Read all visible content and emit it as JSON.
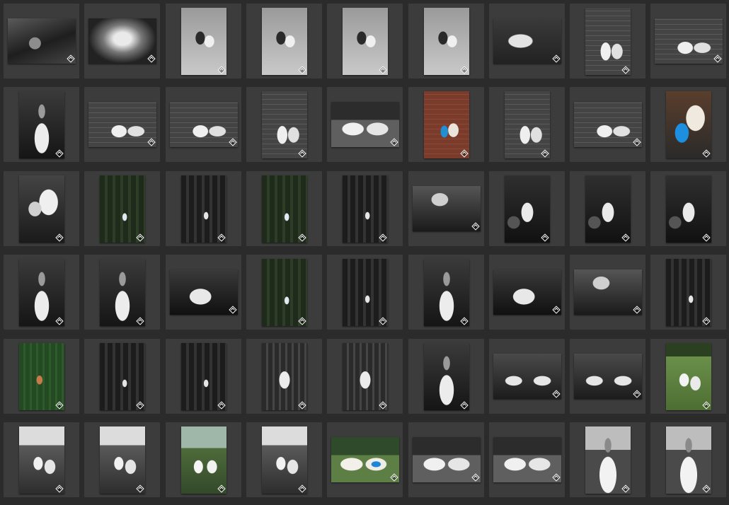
{
  "grid": {
    "columns": 9,
    "rows": [
      [
        "bw-grass",
        "bw-sheet",
        "bw-pair",
        "bw-pair",
        "bw-pair",
        "bw-pair",
        "bw-box",
        "bw-brick2",
        "bw-brick2"
      ],
      [
        "bw-girl",
        "bw-brick2",
        "bw-brick2",
        "bw-brick2",
        "bw-pair2",
        "col-brick",
        "bw-brick2",
        "bw-brick2",
        "col-cast"
      ],
      [
        "bw-cast",
        "col-forest",
        "bw-forest",
        "col-forest",
        "bw-forest",
        "bw-fern",
        "bw-rocks",
        "bw-rocks",
        "bw-rocks"
      ],
      [
        "bw-girl",
        "bw-girl",
        "bw-wide",
        "col-forest",
        "bw-forest",
        "bw-girl",
        "bw-wide",
        "bw-fern",
        "bw-forest"
      ],
      [
        "col-fernsit",
        "bw-forest",
        "bw-forest",
        "bw-ferngrp",
        "bw-ferngrp",
        "bw-girl",
        "bw-arms",
        "bw-arms",
        "col-field"
      ],
      [
        "bw-field",
        "bw-field",
        "col-sky",
        "bw-field",
        "col-pair",
        "bw-pair2",
        "bw-pair2",
        "bw-portrait",
        "bw-portrait"
      ]
    ],
    "orientation": [
      [
        "landscape",
        "landscape",
        "portrait",
        "portrait",
        "portrait",
        "portrait",
        "landscape",
        "portrait",
        "landscape"
      ],
      [
        "portrait",
        "landscape",
        "landscape",
        "portrait",
        "landscape",
        "portrait",
        "portrait",
        "landscape",
        "portrait"
      ],
      [
        "portrait",
        "portrait",
        "portrait",
        "portrait",
        "portrait",
        "landscape",
        "portrait",
        "portrait",
        "portrait"
      ],
      [
        "portrait",
        "portrait",
        "landscape",
        "portrait",
        "portrait",
        "portrait",
        "landscape",
        "landscape",
        "portrait"
      ],
      [
        "portrait",
        "portrait",
        "portrait",
        "portrait",
        "portrait",
        "portrait",
        "landscape",
        "landscape",
        "portrait"
      ],
      [
        "portrait",
        "portrait",
        "portrait",
        "portrait",
        "landscape",
        "landscape",
        "landscape",
        "portrait",
        "portrait"
      ]
    ],
    "badge_icon": "develop-edit-icon",
    "colors": {
      "background": "#2b2b2b",
      "cell": "#3c3c3c"
    }
  }
}
